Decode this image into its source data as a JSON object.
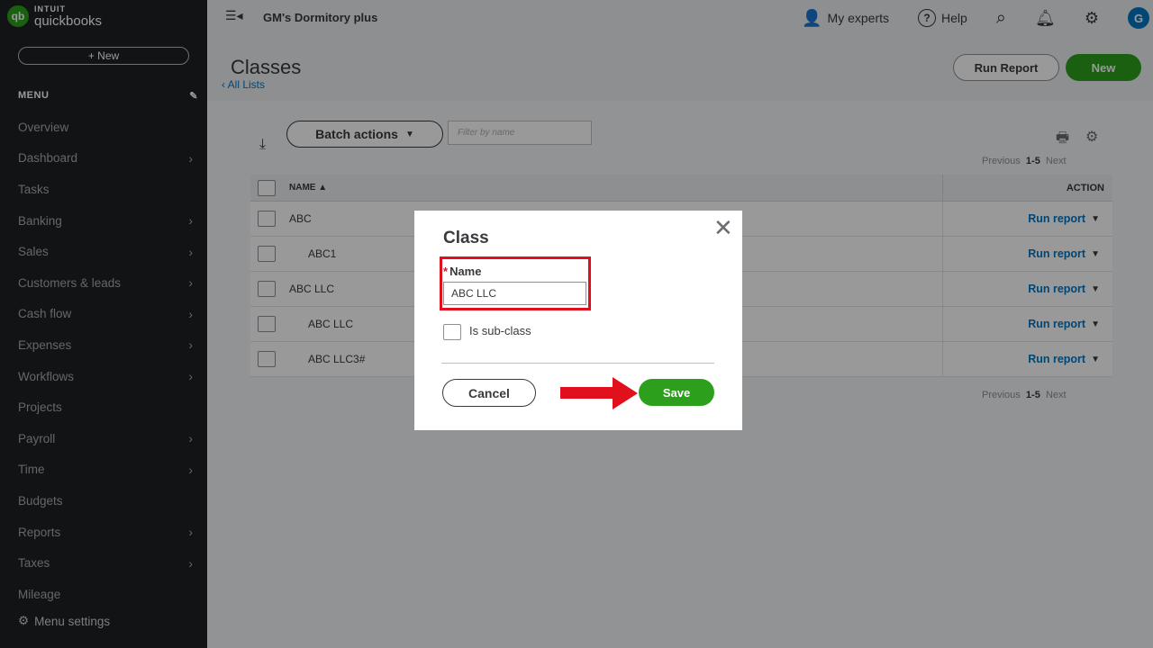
{
  "brand": {
    "intuit": "INTUIT",
    "name": "quickbooks",
    "logo": "qb"
  },
  "sidebar": {
    "new_label": "+ New",
    "menu_heading": "MENU",
    "items": [
      {
        "label": "Overview",
        "chevron": false
      },
      {
        "label": "Dashboard",
        "chevron": true
      },
      {
        "label": "Tasks",
        "chevron": false
      },
      {
        "label": "Banking",
        "chevron": true
      },
      {
        "label": "Sales",
        "chevron": true
      },
      {
        "label": "Customers & leads",
        "chevron": true
      },
      {
        "label": "Cash flow",
        "chevron": true
      },
      {
        "label": "Expenses",
        "chevron": true
      },
      {
        "label": "Workflows",
        "chevron": true
      },
      {
        "label": "Projects",
        "chevron": false
      },
      {
        "label": "Payroll",
        "chevron": true
      },
      {
        "label": "Time",
        "chevron": true
      },
      {
        "label": "Budgets",
        "chevron": false
      },
      {
        "label": "Reports",
        "chevron": true
      },
      {
        "label": "Taxes",
        "chevron": true
      },
      {
        "label": "Mileage",
        "chevron": false
      }
    ],
    "menu_settings": "Menu settings"
  },
  "topbar": {
    "company": "GM's Dormitory plus",
    "my_experts": "My experts",
    "help": "Help",
    "avatar_initial": "G"
  },
  "page": {
    "title": "Classes",
    "back_link": "All Lists",
    "run_report": "Run Report",
    "new": "New"
  },
  "toolbar": {
    "batch_actions": "Batch actions",
    "filter_placeholder": "Filter by name"
  },
  "pager": {
    "previous": "Previous",
    "range": "1-5",
    "next": "Next"
  },
  "table": {
    "col_name": "NAME ▲",
    "col_action": "ACTION",
    "rows": [
      {
        "name": "ABC",
        "action": "Run report"
      },
      {
        "name": "ABC1",
        "action": "Run report"
      },
      {
        "name": "ABC LLC",
        "action": "Run report"
      },
      {
        "name": "ABC LLC",
        "action": "Run report"
      },
      {
        "name": "ABC LLC3#",
        "action": "Run report"
      }
    ]
  },
  "modal": {
    "title": "Class",
    "name_label": "Name",
    "required_mark": "*",
    "name_value": "ABC LLC",
    "subclass_label": "Is sub-class",
    "cancel": "Cancel",
    "save": "Save"
  },
  "colors": {
    "accent_green": "#2ca01c",
    "link_blue": "#0077c5",
    "highlight_red": "#e0101c",
    "sidebar_bg": "#1f2024"
  }
}
